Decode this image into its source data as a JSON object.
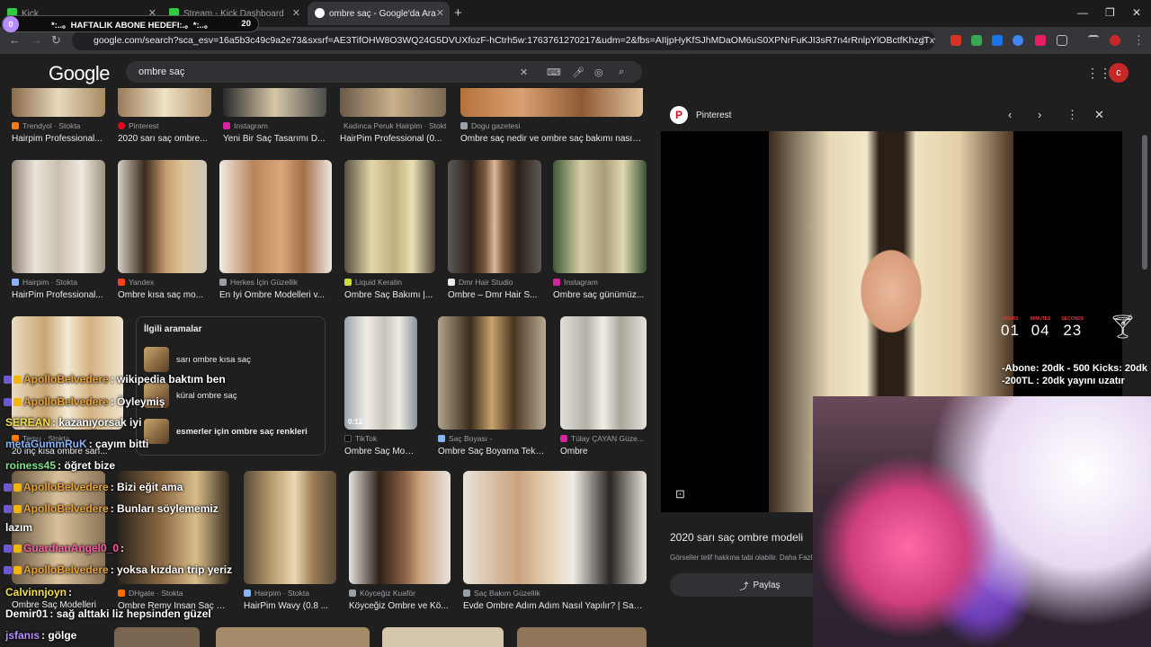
{
  "tabs": [
    {
      "label": "Kick",
      "active": false
    },
    {
      "label": "Stream - Kick Dashboard",
      "active": false
    },
    {
      "label": "ombre saç - Google'da Ara",
      "active": true
    }
  ],
  "goal": {
    "label": "*:..。HAFTALIK ABONE HEDEFI:.。*:..。",
    "count": "20",
    "pill": "0"
  },
  "url": "google.com/search?sca_esv=16a5b3c49c9a2e73&sxsrf=AE3TifOHW8O3WQ24G5DVUXfozF-hCtrh5w:1763761270217&udm=2&fbs=AIIjpHyKfSJhMDaOM6uS0XPNrFuKJI3sR7n4rRnlpYlOBctfKhzgTxwD18cBu4O3I_GKHO94...",
  "google": {
    "logo": "Google",
    "query": "ombre saç",
    "profile_initial": "c"
  },
  "results_row0": [
    {
      "source": "Trendyol · Stokta",
      "title": "Hairpim Professional..."
    },
    {
      "source": "Pinterest",
      "title": "2020 sarı saç ombre..."
    },
    {
      "source": "Instagram",
      "title": "Yeni Bir Saç Tasarımı D..."
    },
    {
      "source": "Kadınca Peruk Hairpim · Stokta",
      "title": "HairPim Professional (0..."
    },
    {
      "source": "Dogu gazetesi",
      "title": "Ombre saç nedir ve ombre saç bakımı nasıl y..."
    }
  ],
  "results_row1": [
    {
      "source": "Hairpim · Stokta",
      "title": "HairPim Professional..."
    },
    {
      "source": "Yandex",
      "title": "Ombre kısa saç mo..."
    },
    {
      "source": "Herkes İçin Güzellik",
      "title": "En İyi Ombre Modelleri v..."
    },
    {
      "source": "Liquid Keratin",
      "title": "Ombre Saç Bakımı |..."
    },
    {
      "source": "Dmr Hair Studio",
      "title": "Ombre – Dmr Hair S..."
    },
    {
      "source": "Instagram",
      "title": "Ombre saç günümüz..."
    }
  ],
  "related": {
    "heading": "İlgili aramalar",
    "items": [
      "sarı ombre kısa saç",
      "küral ombre saç",
      "esmerler için ombre saç renkleri"
    ]
  },
  "results_row2": [
    {
      "source": "TikTok",
      "title": "Ombre Saç Modell...",
      "badge": "0:12"
    },
    {
      "source": "Saç Boyası -",
      "title": "Ombre Saç Boyama Tekn..."
    },
    {
      "source": "Tülay ÇAYAN Güze...",
      "title": "Ombre"
    }
  ],
  "row2_partial": {
    "source": "Temu · Stokta",
    "title": "20 inç kısa ombre sarı..."
  },
  "results_row3": [
    {
      "source": "DHgate · Stokta",
      "title": "Ombre Remy İnsan Saç D..."
    },
    {
      "source": "Hairpim · Stokta",
      "title": "HairPim Wavy (0.8 ..."
    },
    {
      "source": "Köyceğiz Kuaför",
      "title": "Köyceğiz Ombre ve Kö..."
    },
    {
      "source": "Saç Bakım Güzellik",
      "title": "Evde Ombre Adım Adım Nasıl Yapılır? | Saç ..."
    }
  ],
  "row3_partial_title": "Ombre Saç Modelleri",
  "panel": {
    "source": "Pinterest",
    "title": "2020 sarı saç ombre modeli",
    "note": "Görseller telif hakkına tabi olabilir. Daha Fazl",
    "share": "Paylaş"
  },
  "timer": {
    "hours_label": "HOURS",
    "minutes_label": "MINUTES",
    "seconds_label": "SECONDS",
    "hours": "01",
    "minutes": "04",
    "seconds": "23"
  },
  "stream_info": {
    "line1": "-Abone: 20dk - 500 Kicks: 20dk",
    "line2": "-200TL : 20dk yayını uzatır"
  },
  "chat": [
    {
      "user": "ApolloBelvedere",
      "text": ": wikipedia baktım ben",
      "color": "#e8a33a",
      "badges": true
    },
    {
      "user": "ApolloBelvedere",
      "text": ": Öyleymiş",
      "color": "#e8a33a",
      "badges": true
    },
    {
      "user": "SEREAN",
      "text": ": kazanıyorsak iyi",
      "color": "#f4e04d",
      "badges": false
    },
    {
      "user": "metaGummRuK",
      "text": ": çayım bitti",
      "color": "#8ab4f8",
      "badges": false
    },
    {
      "user": "roiness45",
      "text": ": öğret bize",
      "color": "#7ee08a",
      "badges": false
    },
    {
      "user": "ApolloBelvedere",
      "text": ": Bizi eğit ama",
      "color": "#e8a33a",
      "badges": true
    },
    {
      "user": "ApolloBelvedere",
      "text": ": Bunları söylememiz",
      "color": "#e8a33a",
      "badges": true
    },
    {
      "user": "",
      "text": "lazım",
      "color": "#ffffff",
      "badges": false
    },
    {
      "user": "GuardianAngel0_0",
      "text": ":",
      "color": "#ff5fa2",
      "badges": true
    },
    {
      "user": "ApolloBelvedere",
      "text": ": yoksa kızdan trip yeriz",
      "color": "#e8a33a",
      "badges": true
    },
    {
      "user": "Calvinnjoyn",
      "text": ":",
      "color": "#f4e04d",
      "badges": false
    },
    {
      "user": "Demir01",
      "text": ": sağ alttaki liz hepsinden güzel",
      "color": "#ffffff",
      "badges": false
    },
    {
      "user": "jsfanıs",
      "text": ": gölge",
      "color": "#b58cff",
      "badges": false
    }
  ],
  "colors": {
    "bg": "#1f1f1f",
    "accent": "#8ab4f8",
    "kick_green": "#53fc18"
  }
}
